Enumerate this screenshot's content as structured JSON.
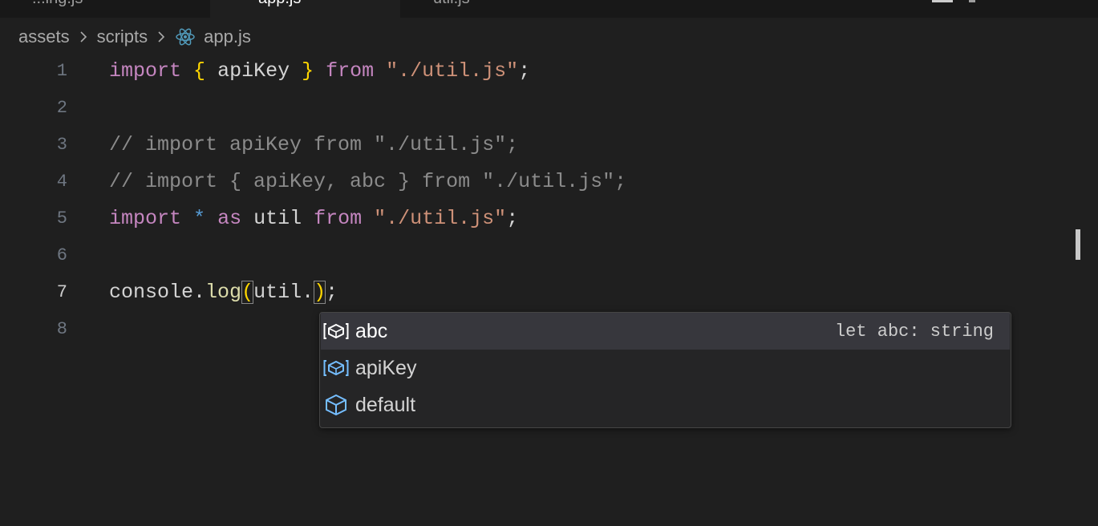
{
  "tabs": [
    {
      "label": "...ing.js",
      "active": false
    },
    {
      "label": "app.js",
      "active": true
    },
    {
      "label": "util.js",
      "active": false
    }
  ],
  "breadcrumb": {
    "items": [
      "assets",
      "scripts"
    ],
    "file": "app.js"
  },
  "editor": {
    "lines": [
      {
        "number": "1"
      },
      {
        "number": "2"
      },
      {
        "number": "3"
      },
      {
        "number": "4"
      },
      {
        "number": "5"
      },
      {
        "number": "6"
      },
      {
        "number": "7"
      },
      {
        "number": "8"
      }
    ],
    "active_line": 7,
    "tokens": {
      "import": "import",
      "from": "from",
      "as": "as",
      "star": "*",
      "open_brace": "{",
      "close_brace": "}",
      "apiKey": "apiKey",
      "util": "util",
      "path": "\"./util.js\"",
      "semi": ";",
      "comment_3": "// import apiKey from \"./util.js\";",
      "comment_4": "// import { apiKey, abc } from \"./util.js\";",
      "console": "console",
      "dot": ".",
      "log": "log",
      "open_paren": "(",
      "close_paren": ")"
    }
  },
  "suggest": {
    "items": [
      {
        "label": "abc",
        "icon": "variable-icon",
        "detail": "let abc: string",
        "selected": true
      },
      {
        "label": "apiKey",
        "icon": "variable-icon",
        "detail": "",
        "selected": false
      },
      {
        "label": "default",
        "icon": "module-icon",
        "detail": "",
        "selected": false
      }
    ]
  },
  "colors": {
    "background": "#1f1f1f",
    "keyword": "#c586c0",
    "string": "#ce9178",
    "bracket": "#ffd700",
    "function": "#dcdcaa",
    "variable": "#9cdcfe",
    "suggest_icon": "#75beff"
  }
}
